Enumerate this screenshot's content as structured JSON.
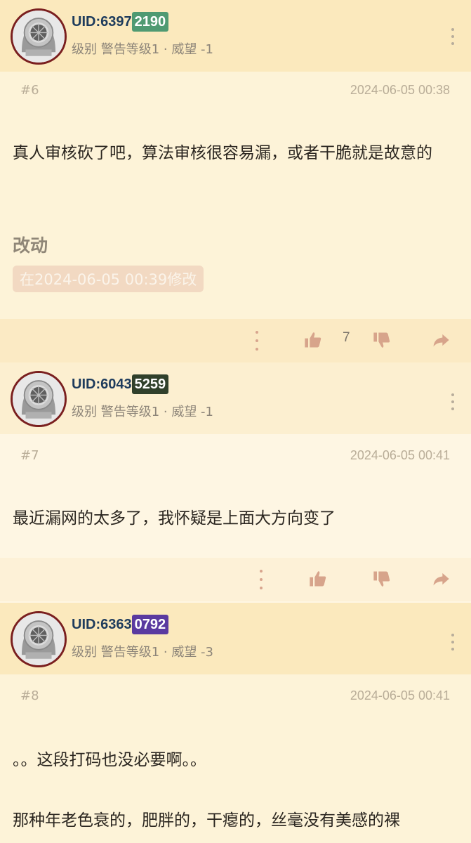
{
  "posts": [
    {
      "uid": "UID:6397",
      "badge": "2190",
      "badge_color": "#4f9a72",
      "meta": "级别 警告等级1 · 威望 -1",
      "floor": "#6",
      "time": "2024-06-05 00:38",
      "content": "真人审核砍了吧，算法审核很容易漏，或者干脆就是故意的",
      "edit_title": "改动",
      "edit_note": "在2024-06-05 00:39修改",
      "like_count": "7"
    },
    {
      "uid": "UID:6043",
      "badge": "5259",
      "badge_color": "#30402b",
      "meta": "级别 警告等级1 · 威望 -1",
      "floor": "#7",
      "time": "2024-06-05 00:41",
      "content": "最近漏网的太多了，我怀疑是上面大方向变了"
    },
    {
      "uid": "UID:6363",
      "badge": "0792",
      "badge_color": "#5a3aa0",
      "meta": "级别 警告等级1 · 威望 -3",
      "floor": "#8",
      "time": "2024-06-05 00:41",
      "content": "。。这段打码也没必要啊。。",
      "content2": "那种年老色衰的，肥胖的，干瘪的，丝毫没有美感的裸"
    }
  ],
  "icons": {
    "avatar": "diving-helmet-avatar",
    "more": "vertical-dots-icon",
    "like": "thumbs-up-icon",
    "dislike": "thumbs-down-icon",
    "share": "share-arrow-icon"
  }
}
